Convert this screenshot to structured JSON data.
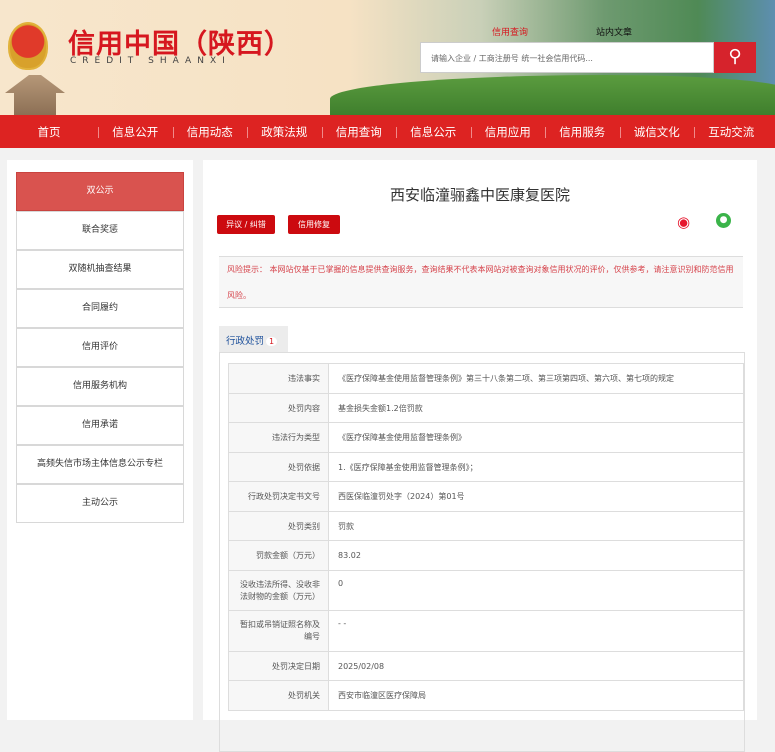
{
  "header": {
    "logo_cn": "信用中国（陕西）",
    "logo_en": "CREDIT   SHAANXI",
    "search_tabs": [
      "信用查询",
      "站内文章"
    ],
    "search_placeholder": "请输入企业 / 工商注册号 统一社会信用代码...",
    "search_icon": "search-icon"
  },
  "nav": [
    "首页",
    "信息公开",
    "信用动态",
    "政策法规",
    "信用查询",
    "信息公示",
    "信用应用",
    "信用服务",
    "诚信文化",
    "互动交流"
  ],
  "sidebar": [
    "双公示",
    "联合奖惩",
    "双随机抽查结果",
    "合同履约",
    "信用评价",
    "信用服务机构",
    "信用承诺",
    "高频失信市场主体信息公示专栏",
    "主动公示"
  ],
  "main": {
    "title": "西安临潼骊鑫中医康复医院",
    "buttons": [
      "异议 / 纠错",
      "信用修复"
    ],
    "risk": "风险提示：  本网站仅基于已掌握的信息提供查询服务，查询结果不代表本网站对被查询对象信用状况的评价，仅供参考，请注意识别和防范信用风险。",
    "tab_label": "行政处罚",
    "tab_count": "1",
    "rows": [
      {
        "k": "违法事实",
        "v": "《医疗保障基金使用监督管理条例》第三十八条第二项、第三项第四项、第六项、第七项的规定"
      },
      {
        "k": "处罚内容",
        "v": "基金损失金额1.2倍罚款"
      },
      {
        "k": "违法行为类型",
        "v": "《医疗保障基金使用监督管理条例》"
      },
      {
        "k": "处罚依据",
        "v": "1.《医疗保障基金使用监督管理条例》；"
      },
      {
        "k": "行政处罚决定书文号",
        "v": "西医保临潼罚处字（2024）第01号"
      },
      {
        "k": "处罚类别",
        "v": "罚款"
      },
      {
        "k": "罚款金额（万元）",
        "v": "83.02"
      },
      {
        "k": "没收违法所得、没收非法财物的金额（万元）",
        "v": "0"
      },
      {
        "k": "暂扣或吊销证照名称及编号",
        "v": "- -"
      },
      {
        "k": "处罚决定日期",
        "v": "2025/02/08"
      },
      {
        "k": "处罚机关",
        "v": "西安市临潼区医疗保障局"
      }
    ]
  }
}
